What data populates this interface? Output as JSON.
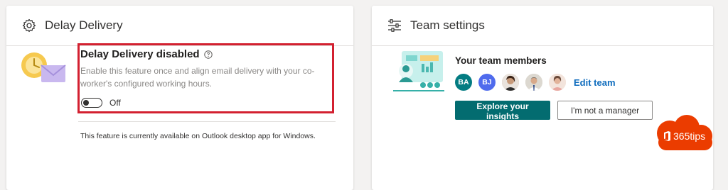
{
  "delay_card": {
    "title": "Delay Delivery",
    "setting_title": "Delay Delivery disabled",
    "description": "Enable this feature once and align email delivery with your co-worker's configured working hours.",
    "toggle_state": "Off",
    "availability_note": "This feature is currently available on Outlook desktop app for Windows."
  },
  "team_card": {
    "title": "Team settings",
    "members_heading": "Your team members",
    "members": [
      {
        "initials": "BA",
        "color": "#037c82"
      },
      {
        "initials": "BJ",
        "color": "#4f6bed"
      },
      {
        "initials": "",
        "type": "photo"
      },
      {
        "initials": "",
        "type": "photo"
      },
      {
        "initials": "",
        "type": "photo"
      }
    ],
    "edit_link": "Edit team",
    "primary_button": "Explore your insights",
    "secondary_button": "I'm not a manager"
  },
  "watermark": {
    "text": "365tips",
    "color": "#eb3c00"
  },
  "colors": {
    "accent_teal": "#036c70",
    "link_blue": "#0f6cbd",
    "highlight_red": "#d32030"
  },
  "icons": [
    "gear-icon",
    "sliders-icon",
    "help-circle-icon",
    "clock-mail-illustration",
    "team-insights-illustration"
  ]
}
